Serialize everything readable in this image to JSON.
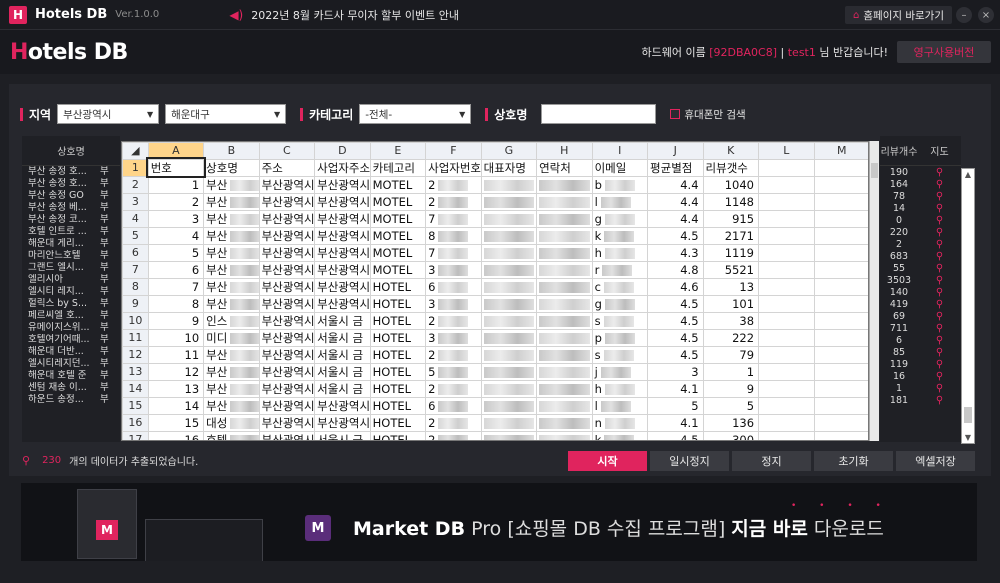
{
  "titlebar": {
    "app_title": "Hotels DB",
    "version": "Ver.1.0.0",
    "notice": "2022년 8월 카드사 무이자 할부 이벤트 안내",
    "homepage": "홈페이지 바로가기",
    "minimize": "–",
    "close": "×"
  },
  "header": {
    "brand_h": "H",
    "brand_rest": "otels DB",
    "hw_label": "하드웨어 이름",
    "hw_id": "[92DBA0C8]",
    "user": "test1",
    "greeting": "님 반갑습니다!",
    "license_button": "영구사용버전"
  },
  "filters": {
    "region_label": "지역",
    "city": "부산광역시",
    "district": "해운대구",
    "category_label": "카테고리",
    "category": "-전체-",
    "name_label": "상호명",
    "name_value": "",
    "closed_checkbox": "휴대폰만 검색"
  },
  "left_list": {
    "header": "상호명",
    "items": [
      "부산 송정 호...",
      "부산 송정 호...",
      "부산 송정 GO",
      "부산 송정 베...",
      "부산 송정 코...",
      "호텔 인트로 ...",
      "해운대 게리...",
      "마리안느호텔",
      "그랜드 엘시...",
      "엘리시아",
      "엘시티 레지...",
      "헐릭스 by S...",
      "페르씨엘 호...",
      "유메이지스위...",
      "호텔여기어때...",
      "해운대 더반...",
      "엘시티레지던...",
      "해운대 호텔 준",
      "센텀 재송 이...",
      "하운드 송정..."
    ],
    "col2": [
      "부",
      "부",
      "부",
      "부",
      "부",
      "부",
      "부",
      "부",
      "부",
      "부",
      "부",
      "부",
      "부",
      "부",
      "부",
      "부",
      "부",
      "부",
      "부",
      "부"
    ]
  },
  "sheet": {
    "columns": [
      "A",
      "B",
      "C",
      "D",
      "E",
      "F",
      "G",
      "H",
      "I",
      "J",
      "K",
      "L",
      "M"
    ],
    "header_row": [
      "번호",
      "상호명",
      "주소",
      "사업자주소",
      "카테고리",
      "사업자번호",
      "대표자명",
      "연락처",
      "이메일",
      "평균별점",
      "리뷰갯수",
      "",
      ""
    ],
    "rows": [
      {
        "n": "1",
        "name": "부산",
        "addr": "부산광역시",
        "baddr": "부산광역시",
        "cat": "MOTEL",
        "biz": "2",
        "email": "b",
        "rating": "4.4",
        "reviews": "1040"
      },
      {
        "n": "2",
        "name": "부산",
        "addr": "부산광역시",
        "baddr": "부산광역시",
        "cat": "MOTEL",
        "biz": "2",
        "email": "l",
        "rating": "4.4",
        "reviews": "1148"
      },
      {
        "n": "3",
        "name": "부산",
        "addr": "부산광역시",
        "baddr": "부산광역시",
        "cat": "MOTEL",
        "biz": "7",
        "email": "g",
        "rating": "4.4",
        "reviews": "915"
      },
      {
        "n": "4",
        "name": "부산",
        "addr": "부산광역시",
        "baddr": "부산광역시",
        "cat": "MOTEL",
        "biz": "8",
        "email": "k",
        "rating": "4.5",
        "reviews": "2171"
      },
      {
        "n": "5",
        "name": "부산",
        "addr": "부산광역시",
        "baddr": "부산광역시",
        "cat": "MOTEL",
        "biz": "7",
        "email": "h",
        "rating": "4.3",
        "reviews": "1119"
      },
      {
        "n": "6",
        "name": "부산",
        "addr": "부산광역시",
        "baddr": "부산광역시",
        "cat": "MOTEL",
        "biz": "3",
        "email": "r",
        "rating": "4.8",
        "reviews": "5521"
      },
      {
        "n": "7",
        "name": "부산",
        "addr": "부산광역시",
        "baddr": "부산광역시",
        "cat": "HOTEL",
        "biz": "6",
        "email": "c",
        "rating": "4.6",
        "reviews": "13"
      },
      {
        "n": "8",
        "name": "부산",
        "addr": "부산광역시",
        "baddr": "부산광역시",
        "cat": "HOTEL",
        "biz": "3",
        "email": "g",
        "rating": "4.5",
        "reviews": "101"
      },
      {
        "n": "9",
        "name": "인스",
        "addr": "부산광역시",
        "baddr": "서울시 금",
        "cat": "HOTEL",
        "biz": "2",
        "email": "s",
        "rating": "4.5",
        "reviews": "38"
      },
      {
        "n": "10",
        "name": "미디",
        "addr": "부산광역시",
        "baddr": "서울시 금",
        "cat": "HOTEL",
        "biz": "3",
        "email": "p",
        "rating": "4.5",
        "reviews": "222"
      },
      {
        "n": "11",
        "name": "부산",
        "addr": "부산광역시",
        "baddr": "서울시 금",
        "cat": "HOTEL",
        "biz": "2",
        "email": "s",
        "rating": "4.5",
        "reviews": "79"
      },
      {
        "n": "12",
        "name": "부산",
        "addr": "부산광역시",
        "baddr": "서울시 금",
        "cat": "HOTEL",
        "biz": "5",
        "email": "j",
        "rating": "3",
        "reviews": "1"
      },
      {
        "n": "13",
        "name": "부산",
        "addr": "부산광역시",
        "baddr": "서울시 금",
        "cat": "HOTEL",
        "biz": "2",
        "email": "h",
        "rating": "4.1",
        "reviews": "9"
      },
      {
        "n": "14",
        "name": "부산",
        "addr": "부산광역시",
        "baddr": "부산광역시",
        "cat": "HOTEL",
        "biz": "6",
        "email": "l",
        "rating": "5",
        "reviews": "5"
      },
      {
        "n": "15",
        "name": "대성",
        "addr": "부산광역시",
        "baddr": "부산광역시",
        "cat": "HOTEL",
        "biz": "2",
        "email": "n",
        "rating": "4.1",
        "reviews": "136"
      },
      {
        "n": "16",
        "name": "호텔",
        "addr": "부산광역시",
        "baddr": "서울시 금",
        "cat": "HOTEL",
        "biz": "2",
        "email": "k",
        "rating": "4.5",
        "reviews": "300"
      }
    ]
  },
  "right_list": {
    "header_count": "리뷰개수",
    "header_map": "지도",
    "counts": [
      "190",
      "164",
      "78",
      "14",
      "0",
      "220",
      "2",
      "683",
      "55",
      "3503",
      "140",
      "419",
      "69",
      "711",
      "6",
      "85",
      "119",
      "16",
      "1",
      "181"
    ]
  },
  "status": {
    "count": "230",
    "message": "개의 데이터가 추출되었습니다."
  },
  "actions": {
    "start": "시작",
    "pause": "일시정지",
    "stop": "정지",
    "reset": "초기화",
    "excel": "엑셀저장"
  },
  "banner": {
    "product": "Market DB",
    "pro": "Pro",
    "desc": "[쇼핑몰 DB 수집 프로그램]",
    "now": "지금 바로",
    "download": "다운로드",
    "logo_letter": "M"
  },
  "colors": {
    "accent": "#e0245e",
    "background": "#1e1f24"
  }
}
